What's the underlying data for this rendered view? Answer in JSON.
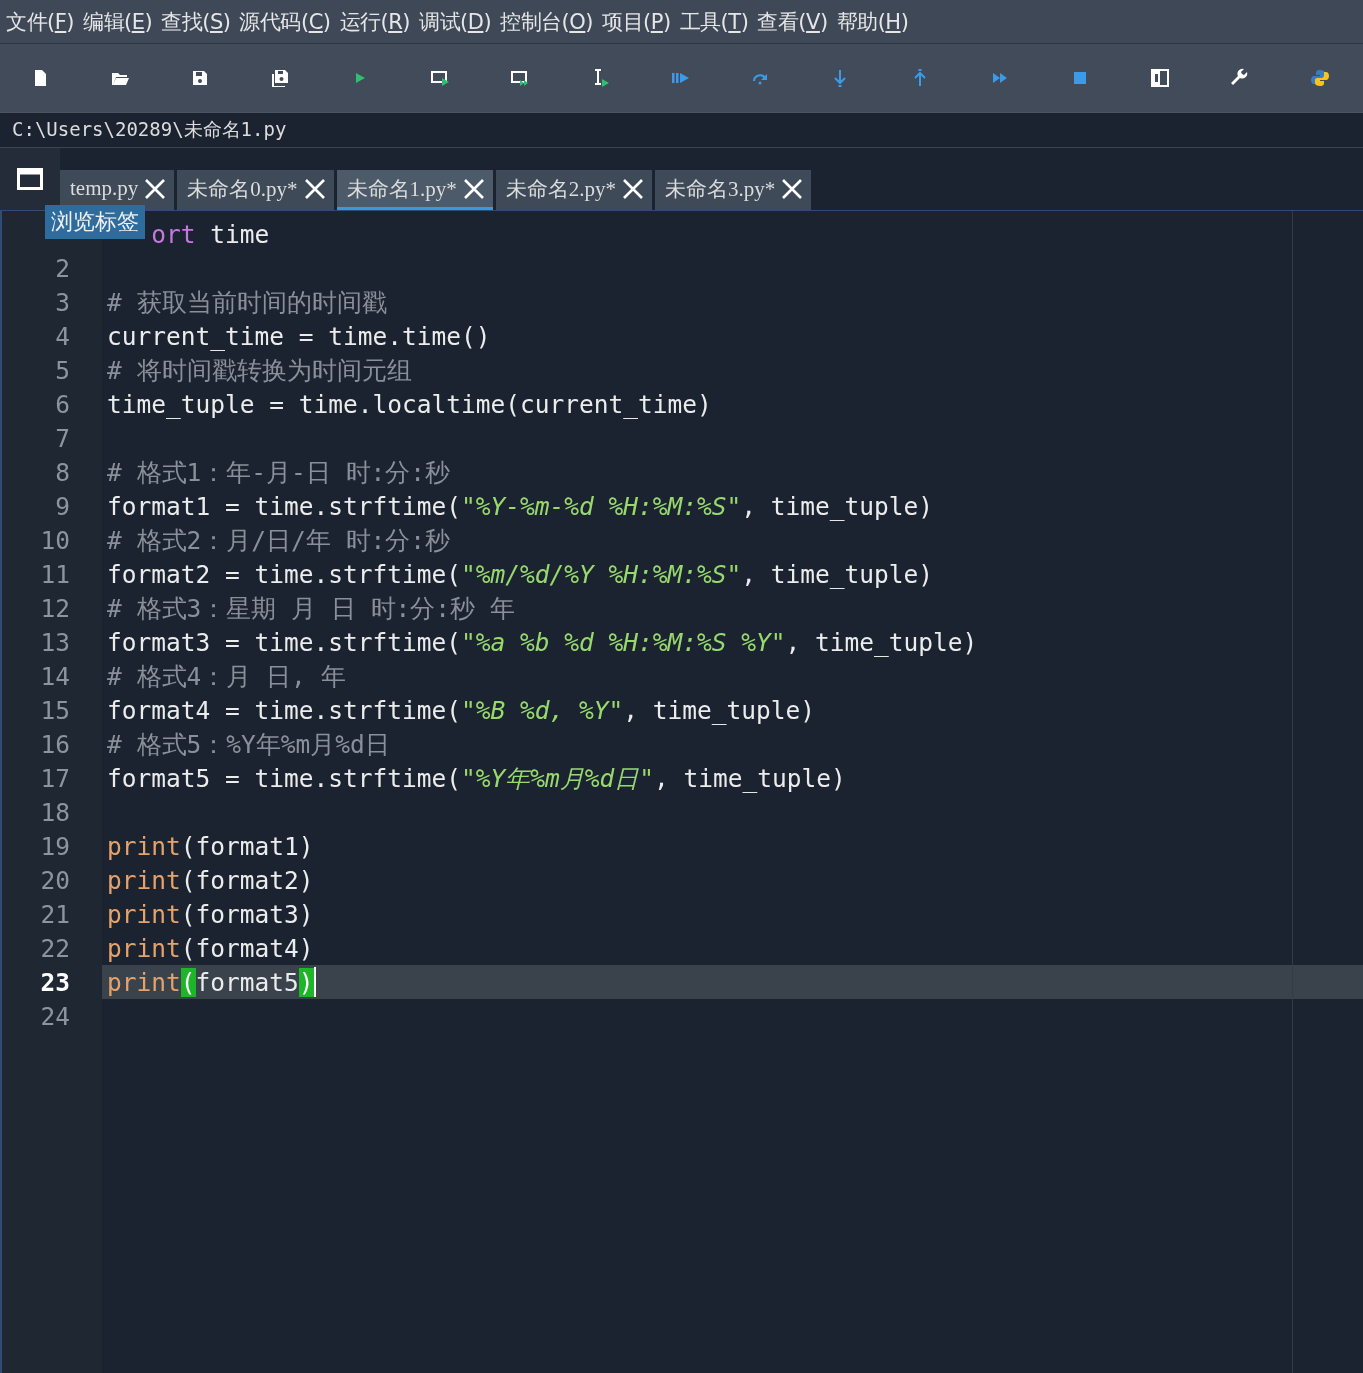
{
  "menu": [
    {
      "before": "文件(",
      "key": "F",
      "after": ")"
    },
    {
      "before": "编辑(",
      "key": "E",
      "after": ")"
    },
    {
      "before": "查找(",
      "key": "S",
      "after": ")"
    },
    {
      "before": "源代码(",
      "key": "C",
      "after": ")"
    },
    {
      "before": "运行(",
      "key": "R",
      "after": ")"
    },
    {
      "before": "调试(",
      "key": "D",
      "after": ")"
    },
    {
      "before": "控制台(",
      "key": "O",
      "after": ")"
    },
    {
      "before": "项目(",
      "key": "P",
      "after": ")"
    },
    {
      "before": "工具(",
      "key": "T",
      "after": ")"
    },
    {
      "before": "查看(",
      "key": "V",
      "after": ")"
    },
    {
      "before": "帮助(",
      "key": "H",
      "after": ")"
    }
  ],
  "path": "C:\\Users\\20289\\未命名1.py",
  "tabs": [
    {
      "label": "temp.py",
      "selected": false
    },
    {
      "label": "未命名0.py*",
      "selected": false
    },
    {
      "label": "未命名1.py*",
      "selected": true
    },
    {
      "label": "未命名2.py*",
      "selected": false
    },
    {
      "label": "未命名3.py*",
      "selected": false
    }
  ],
  "tooltip": "浏览标签",
  "lines": [
    {
      "covered": true,
      "current": false,
      "tokens": [
        {
          "kind": "keyword",
          "text": "ort"
        },
        {
          "kind": "plain",
          "text": " time"
        }
      ]
    },
    {
      "number": "2",
      "covered": false,
      "current": false
    },
    {
      "number": "3",
      "covered": false,
      "current": false,
      "tokens": [
        {
          "kind": "comment",
          "text": "# 获取当前时间的时间戳"
        }
      ]
    },
    {
      "number": "4",
      "covered": false,
      "current": false,
      "tokens": [
        {
          "kind": "plain",
          "text": "current_time = time.time()"
        }
      ]
    },
    {
      "number": "5",
      "covered": false,
      "current": false,
      "tokens": [
        {
          "kind": "comment",
          "text": "# 将时间戳转换为时间元组"
        }
      ]
    },
    {
      "number": "6",
      "covered": false,
      "current": false,
      "tokens": [
        {
          "kind": "plain",
          "text": "time_tuple = time.localtime(current_time)"
        }
      ]
    },
    {
      "number": "7",
      "covered": false,
      "current": false
    },
    {
      "number": "8",
      "covered": false,
      "current": false,
      "tokens": [
        {
          "kind": "comment",
          "text": "# 格式1：年-月-日 时:分:秒"
        }
      ]
    },
    {
      "number": "9",
      "covered": false,
      "current": false,
      "tokens": [
        {
          "kind": "plain",
          "text": "format1 = time.strftime("
        },
        {
          "kind": "string",
          "text": "\"%Y-%m-%d %H:%M:%S\""
        },
        {
          "kind": "plain",
          "text": ", time_tuple)"
        }
      ]
    },
    {
      "number": "10",
      "covered": false,
      "current": false,
      "tokens": [
        {
          "kind": "comment",
          "text": "# 格式2：月/日/年 时:分:秒"
        }
      ]
    },
    {
      "number": "11",
      "covered": false,
      "current": false,
      "tokens": [
        {
          "kind": "plain",
          "text": "format2 = time.strftime("
        },
        {
          "kind": "string",
          "text": "\"%m/%d/%Y %H:%M:%S\""
        },
        {
          "kind": "plain",
          "text": ", time_tuple)"
        }
      ]
    },
    {
      "number": "12",
      "covered": false,
      "current": false,
      "tokens": [
        {
          "kind": "comment",
          "text": "# 格式3：星期 月 日 时:分:秒 年"
        }
      ]
    },
    {
      "number": "13",
      "covered": false,
      "current": false,
      "tokens": [
        {
          "kind": "plain",
          "text": "format3 = time.strftime("
        },
        {
          "kind": "string",
          "text": "\"%a %b %d %H:%M:%S %Y\""
        },
        {
          "kind": "plain",
          "text": ", time_tuple)"
        }
      ]
    },
    {
      "number": "14",
      "covered": false,
      "current": false,
      "tokens": [
        {
          "kind": "comment",
          "text": "# 格式4：月 日, 年"
        }
      ]
    },
    {
      "number": "15",
      "covered": false,
      "current": false,
      "tokens": [
        {
          "kind": "plain",
          "text": "format4 = time.strftime("
        },
        {
          "kind": "string",
          "text": "\"%B %d, %Y\""
        },
        {
          "kind": "plain",
          "text": ", time_tuple)"
        }
      ]
    },
    {
      "number": "16",
      "covered": false,
      "current": false,
      "tokens": [
        {
          "kind": "comment",
          "text": "# 格式5：%Y年%m月%d日"
        }
      ]
    },
    {
      "number": "17",
      "covered": false,
      "current": false,
      "tokens": [
        {
          "kind": "plain",
          "text": "format5 = time.strftime("
        },
        {
          "kind": "string",
          "text": "\"%Y年%m月%d日\""
        },
        {
          "kind": "plain",
          "text": ", time_tuple)"
        }
      ]
    },
    {
      "number": "18",
      "covered": false,
      "current": false
    },
    {
      "number": "19",
      "covered": false,
      "current": false,
      "tokens": [
        {
          "kind": "builtin",
          "text": "print"
        },
        {
          "kind": "plain",
          "text": "(format1)"
        }
      ]
    },
    {
      "number": "20",
      "covered": false,
      "current": false,
      "tokens": [
        {
          "kind": "builtin",
          "text": "print"
        },
        {
          "kind": "plain",
          "text": "(format2)"
        }
      ]
    },
    {
      "number": "21",
      "covered": false,
      "current": false,
      "tokens": [
        {
          "kind": "builtin",
          "text": "print"
        },
        {
          "kind": "plain",
          "text": "(format3)"
        }
      ]
    },
    {
      "number": "22",
      "covered": false,
      "current": false,
      "tokens": [
        {
          "kind": "builtin",
          "text": "print"
        },
        {
          "kind": "plain",
          "text": "(format4)"
        }
      ]
    },
    {
      "number": "23",
      "covered": false,
      "current": true,
      "tokens": [
        {
          "kind": "builtin",
          "text": "print"
        },
        {
          "kind": "match",
          "text": "("
        },
        {
          "kind": "plain",
          "text": "format5"
        },
        {
          "kind": "match",
          "text": ")"
        }
      ]
    },
    {
      "number": "24",
      "covered": false,
      "current": false
    }
  ]
}
